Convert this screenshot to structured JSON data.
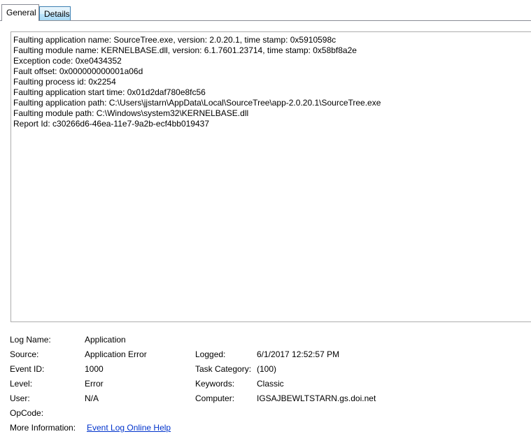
{
  "tabs": [
    {
      "label": "General",
      "active": true
    },
    {
      "label": "Details",
      "active": false
    }
  ],
  "description": [
    "Faulting application name: SourceTree.exe, version: 2.0.20.1, time stamp: 0x5910598c",
    "Faulting module name: KERNELBASE.dll, version: 6.1.7601.23714, time stamp: 0x58bf8a2e",
    "Exception code: 0xe0434352",
    "Fault offset: 0x000000000001a06d",
    "Faulting process id: 0x2254",
    "Faulting application start time: 0x01d2daf780e8fc56",
    "Faulting application path: C:\\Users\\jjstarn\\AppData\\Local\\SourceTree\\app-2.0.20.1\\SourceTree.exe",
    "Faulting module path: C:\\Windows\\system32\\KERNELBASE.dll",
    "Report Id: c30266d6-46ea-11e7-9a2b-ecf4bb019437"
  ],
  "fields": {
    "log_name": {
      "label": "Log Name:",
      "value": "Application"
    },
    "source": {
      "label": "Source:",
      "value": "Application Error"
    },
    "logged": {
      "label": "Logged:",
      "value": "6/1/2017 12:52:57 PM"
    },
    "event_id": {
      "label": "Event ID:",
      "value": "1000"
    },
    "task_category": {
      "label": "Task Category:",
      "value": "(100)"
    },
    "level": {
      "label": "Level:",
      "value": "Error"
    },
    "keywords": {
      "label": "Keywords:",
      "value": "Classic"
    },
    "user": {
      "label": "User:",
      "value": "N/A"
    },
    "computer": {
      "label": "Computer:",
      "value": "IGSAJBEWLTSTARN.gs.doi.net"
    },
    "opcode": {
      "label": "OpCode:",
      "value": ""
    },
    "more_info": {
      "label": "More Information:",
      "value": "Event Log Online Help"
    }
  }
}
